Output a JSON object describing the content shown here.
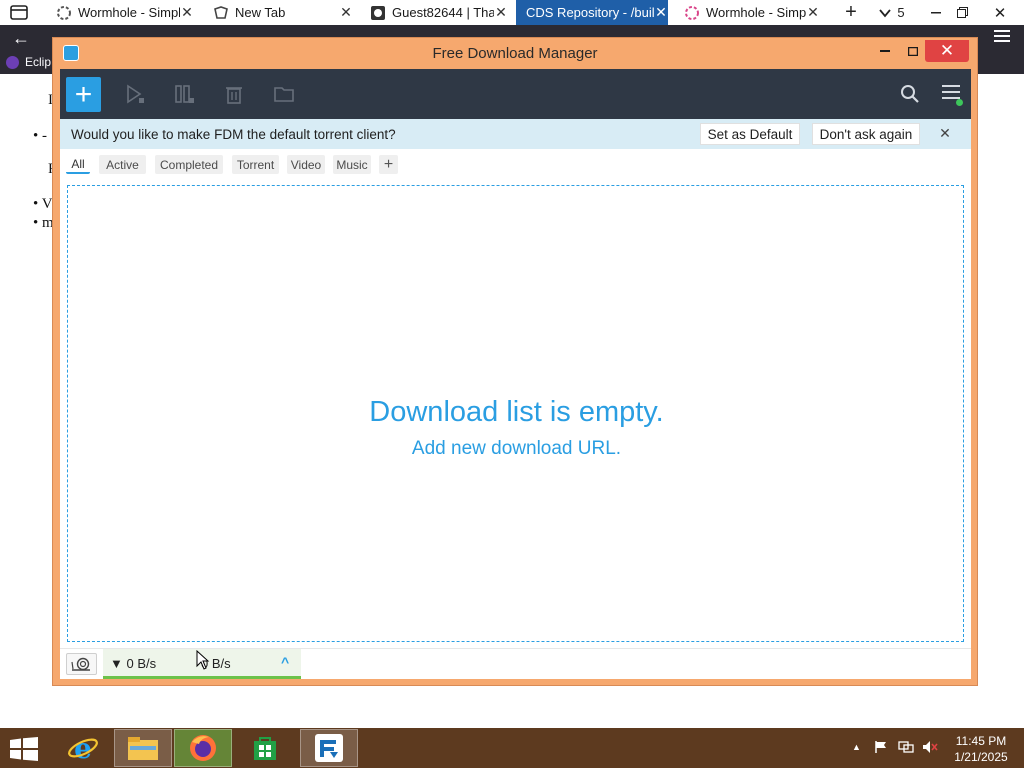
{
  "browser": {
    "tabs": [
      {
        "title": "Wormhole - Simpl",
        "active": false
      },
      {
        "title": "New Tab",
        "active": false
      },
      {
        "title": "Guest82644 | Than",
        "active": false
      },
      {
        "title": "CDS Repository - /buil",
        "active": true
      },
      {
        "title": "Wormhole - Simpl",
        "active": false
      }
    ],
    "tab_count": "5",
    "bookmark_label": "Eclip"
  },
  "background_page": {
    "line1": "I",
    "bullet1": "•  -",
    "line2": "F",
    "bullet2": "•  V",
    "bullet3": "•  m"
  },
  "fdm": {
    "window_title": "Free Download Manager",
    "banner": {
      "message": "Would you like to make FDM the default torrent client?",
      "set_default_label": "Set as Default",
      "dont_ask_label": "Don't ask again"
    },
    "filters": [
      "All",
      "Active",
      "Completed",
      "Torrent",
      "Video",
      "Music"
    ],
    "selected_filter": "All",
    "empty_title": "Download list is empty.",
    "empty_subtitle": "Add new download URL.",
    "status": {
      "download_speed": "▼ 0 B/s",
      "upload_speed": "0 B/s"
    },
    "accent_color": "#2a9ee2"
  },
  "taskbar": {
    "apps": [
      "internet-explorer",
      "file-explorer",
      "firefox",
      "store",
      "free-download-manager"
    ],
    "time": "11:45 PM",
    "date": "1/21/2025"
  }
}
